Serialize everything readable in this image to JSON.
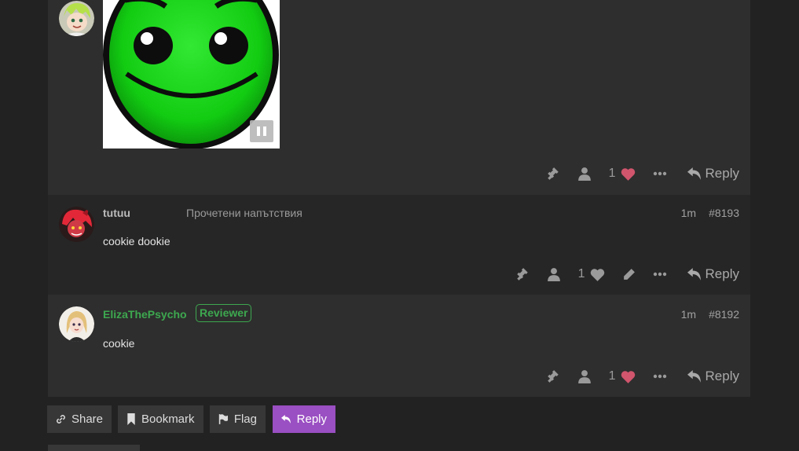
{
  "colors": {
    "background": "#222222",
    "post_bg": "#2e2e2e",
    "like_active": "#d0556d",
    "flair_green": "#3da84f",
    "primary_button": "#9a4fc2"
  },
  "posts": [
    {
      "avatar": "green-haired-anime-avatar",
      "image": "green-smiley-face-gif",
      "actions": {
        "like_count": "1",
        "liked": true,
        "reply_label": "Reply"
      }
    },
    {
      "username": "tutuu",
      "user_title": "Прочетени напътствия",
      "time": "1m",
      "post_number": "#8193",
      "body": "cookie dookie",
      "actions": {
        "like_count": "1",
        "liked": false,
        "reply_label": "Reply"
      }
    },
    {
      "username": "ElizaThePsycho",
      "flair": "Reviewer",
      "time": "1m",
      "post_number": "#8192",
      "body": "cookie",
      "actions": {
        "like_count": "1",
        "liked": true,
        "reply_label": "Reply"
      }
    }
  ],
  "footer": {
    "share_label": "Share",
    "bookmark_label": "Bookmark",
    "flag_label": "Flag",
    "reply_label": "Reply"
  }
}
